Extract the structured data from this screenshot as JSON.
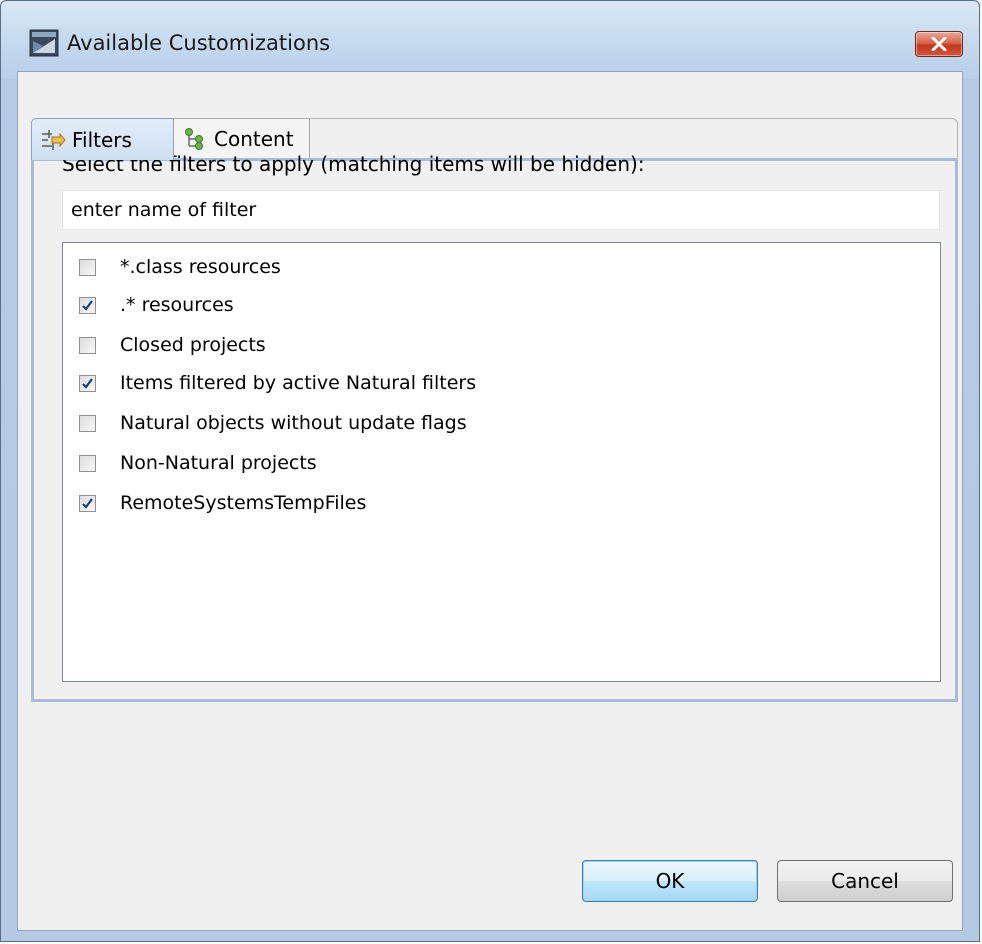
{
  "window": {
    "title": "Available Customizations",
    "app_icon": "eclipse-window-icon",
    "close_icon": "close-icon"
  },
  "tabs": [
    {
      "label": "Filters",
      "icon": "filters-icon",
      "active": true
    },
    {
      "label": "Content",
      "icon": "content-tree-icon",
      "active": false
    }
  ],
  "filters": {
    "instruction": "Select the filters to apply (matching items will be hidden):",
    "search_placeholder": "enter name of filter",
    "items": [
      {
        "label": "*.class resources",
        "checked": false
      },
      {
        "label": ".* resources",
        "checked": true
      },
      {
        "label": "Closed projects",
        "checked": false
      },
      {
        "label": "Items filtered by active Natural filters",
        "checked": true
      },
      {
        "label": "Natural objects without update flags",
        "checked": false
      },
      {
        "label": "Non-Natural projects",
        "checked": false
      },
      {
        "label": "RemoteSystemsTempFiles",
        "checked": true
      }
    ]
  },
  "buttons": {
    "ok": "OK",
    "cancel": "Cancel"
  },
  "colors": {
    "title_bar": "#c7dbf0",
    "close_button": "#c4381d",
    "default_button": "#bee6fd",
    "checkmark": "#1c3c7a"
  }
}
